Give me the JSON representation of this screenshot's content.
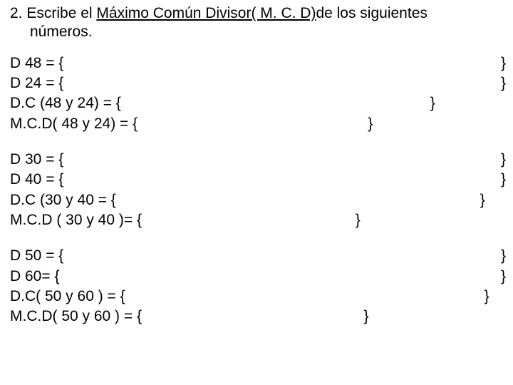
{
  "heading": {
    "num": "2. ",
    "pre": "Escribe el ",
    "term": "Máximo Común Divisor( M. C. D)",
    "post": "de los siguientes",
    "line2": "números."
  },
  "blocks": [
    {
      "rows": [
        {
          "label": "D 48 = {",
          "tail": "}",
          "tail_pad": ""
        },
        {
          "label": "D 24 = {",
          "tail": "}",
          "tail_pad": ""
        },
        {
          "label": "D.C (48 y 24) = {",
          "tail": "}",
          "tail_pad": "                 "
        },
        {
          "label": "M.C.D( 48 y 24) = {",
          "tail": "}",
          "tail_pad": "                                "
        }
      ]
    },
    {
      "rows": [
        {
          "label": "D 30 = {",
          "tail": "}",
          "tail_pad": ""
        },
        {
          "label": "D 40 = {",
          "tail": "}",
          "tail_pad": ""
        },
        {
          "label": "D.C (30 y 40 = {",
          "tail": "}",
          "tail_pad": "     "
        },
        {
          "label": "M.C.D ( 30 y 40 )= {",
          "tail": "}",
          "tail_pad": "                                   "
        }
      ]
    },
    {
      "rows": [
        {
          "label": "D 50 = {",
          "tail": "}",
          "tail_pad": ""
        },
        {
          "label": "D 60= {",
          "tail": "}",
          "tail_pad": ""
        },
        {
          "label": "D.C( 50 y 60 ) = {",
          "tail": "}",
          "tail_pad": "    "
        },
        {
          "label": "M.C.D( 50 y 60 ) = {",
          "tail": "}",
          "tail_pad": "                                 "
        }
      ]
    }
  ]
}
